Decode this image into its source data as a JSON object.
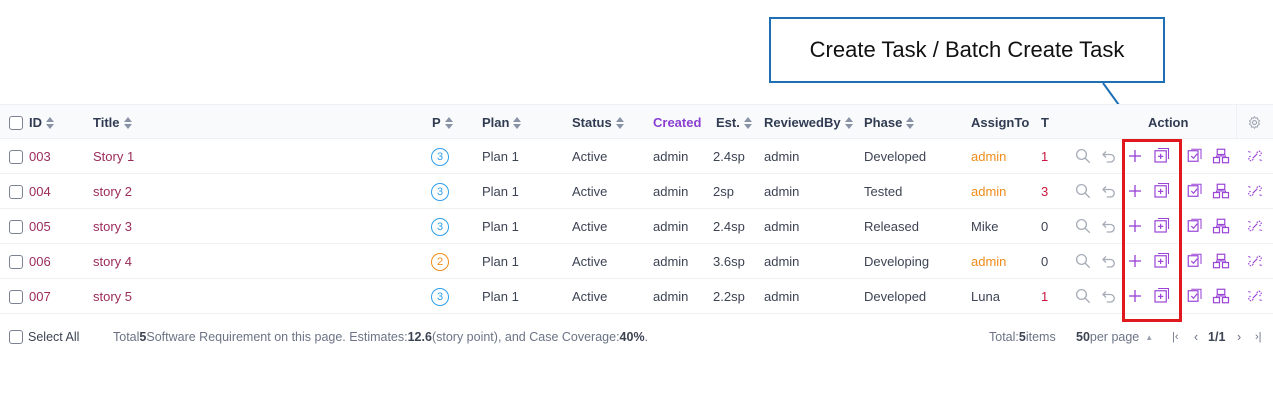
{
  "annotation": {
    "callout_text": "Create Task / Batch Create Task",
    "box_color": "#1f6fb5",
    "highlight_color": "#e0191e"
  },
  "columns": {
    "id": "ID",
    "title": "Title",
    "priority": "P",
    "plan": "Plan",
    "status": "Status",
    "created": "Created",
    "estimate": "Est.",
    "reviewed_by": "ReviewedBy",
    "phase": "Phase",
    "assign_to": "AssignTo",
    "tasks": "T",
    "action": "Action"
  },
  "rows": [
    {
      "id": "003",
      "title": "Story 1",
      "priority": "3",
      "plan": "Plan 1",
      "status": "Active",
      "created": "admin",
      "estimate": "2.4sp",
      "reviewed_by": "admin",
      "phase": "Developed",
      "assign_to": "admin",
      "tasks": "1"
    },
    {
      "id": "004",
      "title": "story 2",
      "priority": "3",
      "plan": "Plan 1",
      "status": "Active",
      "created": "admin",
      "estimate": "2sp",
      "reviewed_by": "admin",
      "phase": "Tested",
      "assign_to": "admin",
      "tasks": "3"
    },
    {
      "id": "005",
      "title": "story 3",
      "priority": "3",
      "plan": "Plan 1",
      "status": "Active",
      "created": "admin",
      "estimate": "2.4sp",
      "reviewed_by": "admin",
      "phase": "Released",
      "assign_to": "Mike",
      "tasks": "0"
    },
    {
      "id": "006",
      "title": "story 4",
      "priority": "2",
      "plan": "Plan 1",
      "status": "Active",
      "created": "admin",
      "estimate": "3.6sp",
      "reviewed_by": "admin",
      "phase": "Developing",
      "assign_to": "admin",
      "tasks": "0"
    },
    {
      "id": "007",
      "title": "story 5",
      "priority": "3",
      "plan": "Plan 1",
      "status": "Active",
      "created": "admin",
      "estimate": "2.2sp",
      "reviewed_by": "admin",
      "phase": "Developed",
      "assign_to": "Luna",
      "tasks": "1"
    }
  ],
  "row_styles": {
    "assign_highlight_for": [
      "admin"
    ],
    "tasks_red_nonzero": true
  },
  "footer": {
    "select_all": "Select All",
    "summary_prefix": "Total ",
    "summary_count": "5",
    "summary_middle": " Software Requirement on this page. Estimates: ",
    "summary_estimate": "12.6",
    "summary_after_estimate": " (story point), and Case Coverage: ",
    "summary_coverage": "40%",
    "summary_end": ".",
    "total_prefix": "Total: ",
    "total_count": "5",
    "total_suffix": " items",
    "per_page_count": "50",
    "per_page_label": " per page",
    "page_current": "1",
    "page_total": "1"
  },
  "icons": {
    "settings": "gear-icon",
    "actions": [
      "search-icon",
      "undo-icon",
      "create-task-icon",
      "batch-create-task-icon",
      "link-case-icon",
      "split-icon",
      "unlink-icon"
    ]
  },
  "colors": {
    "id_text": "#9b2c5a",
    "priority_3": "#2fa0ea",
    "priority_2": "#f08c1b",
    "assign_admin": "#f08c1b",
    "tasks_nonzero": "#c8183f",
    "action_purple": "#9a45d6",
    "created_header": "#8a3fd1"
  }
}
